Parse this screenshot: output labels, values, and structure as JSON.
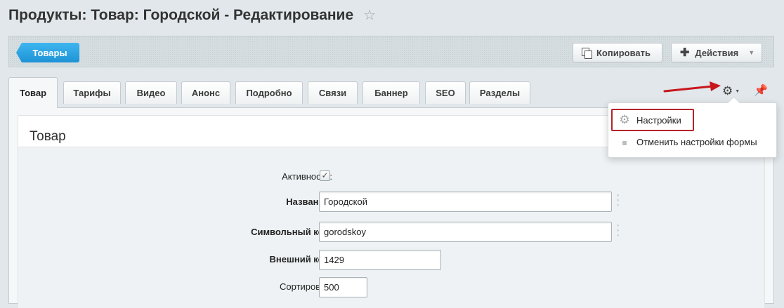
{
  "page": {
    "title": "Продукты: Товар: Городской - Редактирование",
    "star_icon": "star-icon"
  },
  "toolbar": {
    "back_label": "Товары",
    "copy_label": "Копировать",
    "actions_label": "Действия",
    "back_color": "#1d93d6"
  },
  "tabs": [
    {
      "label": "Товар",
      "active": true
    },
    {
      "label": "Тарифы"
    },
    {
      "label": "Видео"
    },
    {
      "label": "Анонс"
    },
    {
      "label": "Подробно"
    },
    {
      "label": "Связи"
    },
    {
      "label": "Баннер"
    },
    {
      "label": "SEO"
    },
    {
      "label": "Разделы"
    }
  ],
  "section": {
    "title": "Товар"
  },
  "form": {
    "active_label": "Активность:",
    "active_checked": true,
    "name_label": "Название:",
    "name_value": "Городской",
    "code_label": "Символьный код:",
    "code_value": "gorodskoy",
    "external_label": "Внешний код:",
    "external_value": "1429",
    "sort_label": "Сортировка:",
    "sort_value": "500"
  },
  "settings_menu": {
    "items": [
      {
        "label": "Настройки",
        "icon": "gear-icon"
      },
      {
        "label": "Отменить настройки формы",
        "icon": "square-bullet-icon"
      }
    ],
    "highlight_color": "#b4232a"
  },
  "annotation": {
    "arrow_color": "#c8161d"
  }
}
